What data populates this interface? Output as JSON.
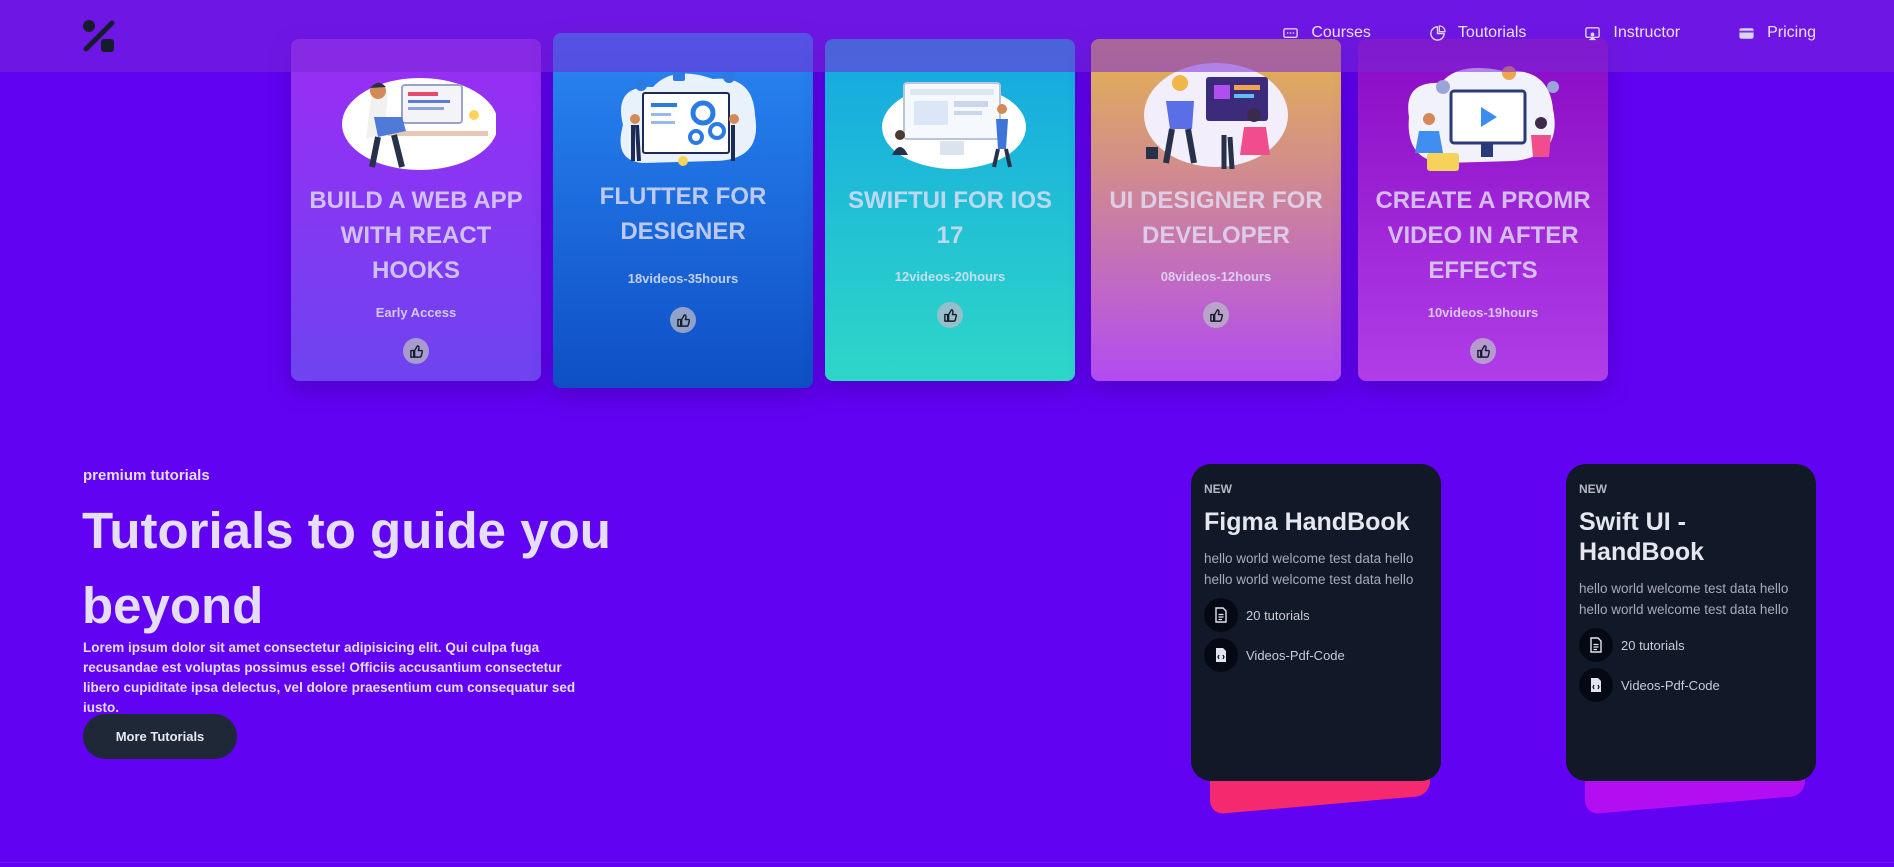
{
  "nav": {
    "items": [
      {
        "label": "Courses",
        "icon": "monitor-icon"
      },
      {
        "label": "Toutorials",
        "icon": "pie-chart-icon"
      },
      {
        "label": "Instructor",
        "icon": "chalkboard-user-icon"
      },
      {
        "label": "Pricing",
        "icon": "credit-card-icon"
      }
    ]
  },
  "courses": [
    {
      "title": "BUILD A WEB APP WITH REACT HOOKS",
      "meta": "Early Access",
      "gradient": [
        "#9b2cf5",
        "#6e44f0"
      ]
    },
    {
      "title": "FLUTTER FOR DESIGNER",
      "meta": "18videos-35hours",
      "gradient": [
        "#2a86f3",
        "#0e4fc4"
      ]
    },
    {
      "title": "SWIFTUI FOR IOS 17",
      "meta": "12videos-20hours",
      "gradient": [
        "#14a7e2",
        "#2ed7c7"
      ]
    },
    {
      "title": "UI DESIGNER FOR DEVELOPER",
      "meta": "08videos-12hours",
      "gradient": [
        "#e4b44e",
        "#b24bf2"
      ]
    },
    {
      "title": "CREATE A PROMR VIDEO IN AFTER EFFECTS",
      "meta": "10videos-19hours",
      "gradient": [
        "#8a0ac3",
        "#b03ee8"
      ]
    }
  ],
  "hero": {
    "eyebrow": "premium tutorials",
    "title": "Tutorials to guide you beyond",
    "body": "Lorem ipsum dolor sit amet consectetur adipisicing elit. Qui culpa fuga recusandae est voluptas possimus esse! Officiis accusantium consectetur libero cupiditate ipsa delectus, vel dolore praesentium cum consequatur sed iusto.",
    "button": "More Tutorials"
  },
  "books": [
    {
      "badge": "NEW",
      "title": "Figma HandBook",
      "desc": "hello world welcome test data hello hello world welcome test data hello",
      "count": "20 tutorials",
      "formats": "Videos-Pdf-Code",
      "accent": "#f5296e"
    },
    {
      "badge": "NEW",
      "title": "Swift UI - HandBook",
      "desc": "hello world welcome test data hello hello world welcome test data hello",
      "count": "20 tutorials",
      "formats": "Videos-Pdf-Code",
      "accent": "#b30ef2"
    }
  ]
}
